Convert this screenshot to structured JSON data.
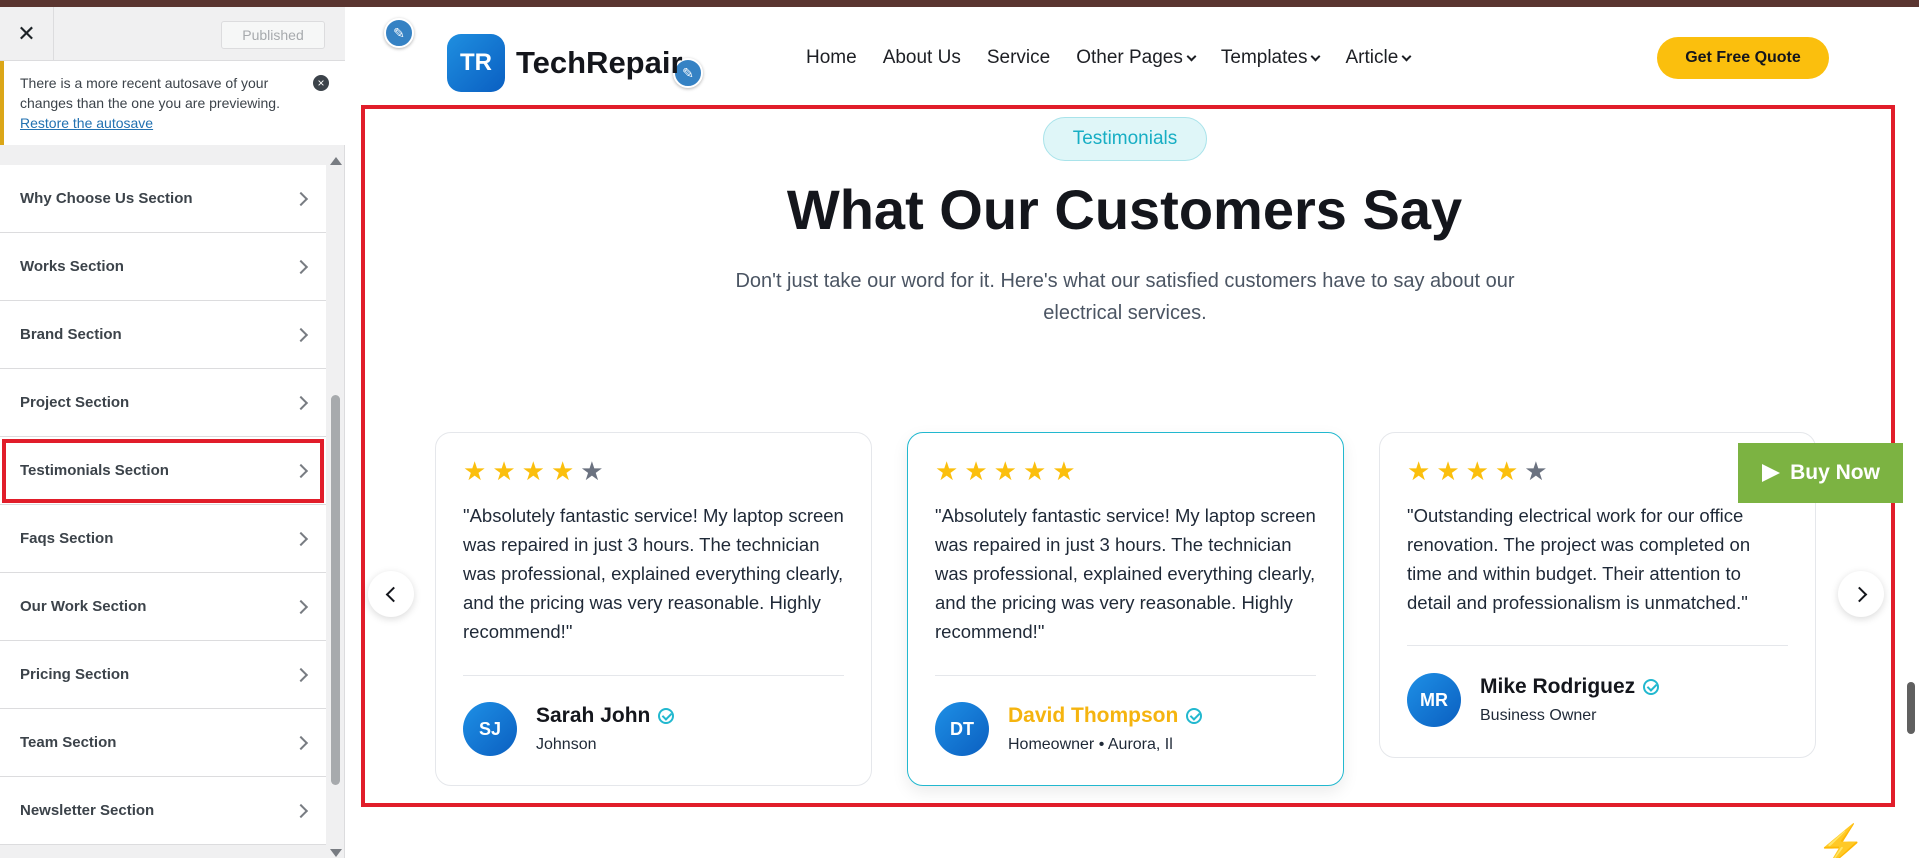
{
  "sidebar": {
    "close_icon": "✕",
    "publish_label": "Published",
    "notice": {
      "text": "There is a more recent autosave of your changes than the one you are previewing.",
      "link": "Restore the autosave"
    },
    "items": [
      {
        "label": "Why Choose Us Section"
      },
      {
        "label": "Works Section"
      },
      {
        "label": "Brand Section"
      },
      {
        "label": "Project Section"
      },
      {
        "label": "Testimonials Section"
      },
      {
        "label": "Faqs Section"
      },
      {
        "label": "Our Work Section"
      },
      {
        "label": "Pricing Section"
      },
      {
        "label": "Team Section"
      },
      {
        "label": "Newsletter Section"
      }
    ]
  },
  "header": {
    "logo_initials": "TR",
    "logo_text": "TechRepair",
    "nav": {
      "home": "Home",
      "about": "About Us",
      "service": "Service",
      "other": "Other Pages",
      "templates": "Templates",
      "article": "Article"
    },
    "cta": "Get Free Quote"
  },
  "testimonials": {
    "tag": "Testimonials",
    "title": "What Our Customers Say",
    "subtitle": "Don't just take our word for it. Here's what our satisfied customers have to say about our electrical services.",
    "cards": [
      {
        "rating": 4,
        "quote": "\"Absolutely fantastic service! My laptop screen was repaired in just 3 hours. The technician was professional, explained everything clearly, and the pricing was very reasonable. Highly recommend!\"",
        "initials": "SJ",
        "name": "Sarah John",
        "role": "Johnson"
      },
      {
        "rating": 5,
        "quote": "\"Absolutely fantastic service! My laptop screen was repaired in just 3 hours. The technician was professional, explained everything clearly, and the pricing was very reasonable. Highly recommend!\"",
        "initials": "DT",
        "name": "David Thompson",
        "role": "Homeowner • Aurora, Il"
      },
      {
        "rating": 4,
        "quote": "\"Outstanding electrical work for our office renovation. The project was completed on time and within budget. Their attention to detail and professionalism is unmatched.\"",
        "initials": "MR",
        "name": "Mike Rodriguez",
        "role": "Business Owner"
      }
    ]
  },
  "buy_now": "Buy Now",
  "colors": {
    "accent": "#fbbf0d",
    "teal": "#22b8cf",
    "highlight": "#e11d2a",
    "buy_now": "#7cb342"
  }
}
